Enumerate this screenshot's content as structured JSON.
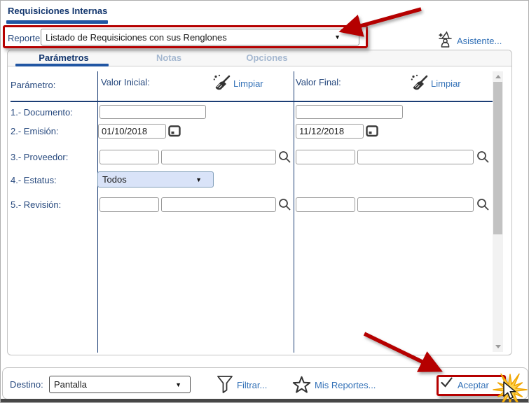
{
  "window": {
    "title": "Requisiciones Internas"
  },
  "report_selector": {
    "label": "Reporte:",
    "value": "Listado de Requisiciones con sus Renglones"
  },
  "assistant_label": "Asistente...",
  "tabs": [
    {
      "label": "Parámetros",
      "active": true
    },
    {
      "label": "Notas",
      "active": false
    },
    {
      "label": "Opciones",
      "active": false
    }
  ],
  "parameters": {
    "header": {
      "param": "Parámetro:",
      "initial": "Valor Inicial:",
      "final": "Valor Final:",
      "clear": "Limpiar"
    },
    "rows": [
      {
        "label": "1.- Documento:",
        "initial_value": "",
        "final_value": ""
      },
      {
        "label": "2.- Emisión:",
        "initial_value": "01/10/2018",
        "final_value": "11/12/2018"
      },
      {
        "label": "3.- Proveedor:",
        "initial_code": "",
        "initial_desc": "",
        "final_code": "",
        "final_desc": ""
      },
      {
        "label": "4.- Estatus:",
        "initial_value": "Todos"
      },
      {
        "label": "5.- Revisión:",
        "initial_code": "",
        "initial_desc": "",
        "final_code": "",
        "final_desc": ""
      }
    ]
  },
  "footer": {
    "destination_label": "Destino:",
    "destination_value": "Pantalla",
    "filter_label": "Filtrar...",
    "my_reports_label": "Mis Reportes...",
    "accept_label": "Aceptar"
  },
  "glyphs": {
    "caret": "▼"
  },
  "icons": {
    "assistant": "wizard-icon",
    "clear": "broom-icon",
    "calendar": "calendar-icon",
    "lookup": "magnifier-icon",
    "filter": "funnel-icon",
    "my_reports": "star-icon",
    "accept": "checkmark-icon"
  },
  "colors": {
    "accent_navy": "#14376e",
    "rule_navy": "#1c3e75",
    "link_blue": "#3371b7",
    "tab_inactive": "#a5b8d0",
    "estatus_bg": "#d9e3f8",
    "annotation_red": "#b50000",
    "starburst_yellow": "#ffd34d"
  }
}
